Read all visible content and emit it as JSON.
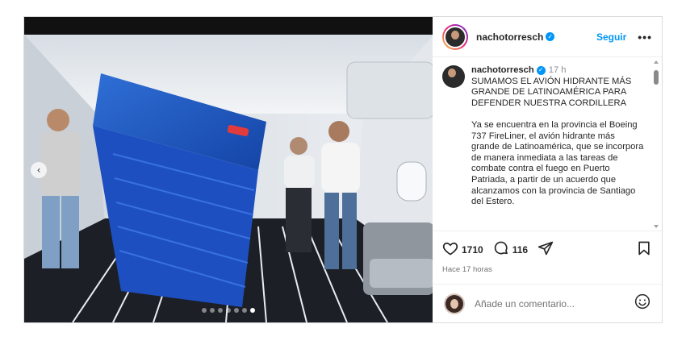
{
  "post": {
    "username": "nachotorresch",
    "follow_label": "Seguir",
    "more_label": "•••",
    "caption": {
      "time": "17 h",
      "headline": "SUMAMOS EL AVIÓN HIDRANTE MÁS GRANDE DE LATINOAMÉRICA PARA DEFENDER NUESTRA CORDILLERA",
      "body": "Ya se encuentra en la provincia el Boeing 737 FireLiner, el avión hidrante más grande de Latinoamérica, que se incorpora de manera inmediata a las tareas de combate contra el fuego en Puerto Patriada, a partir de un acuerdo que alcanzamos con la provincia de Santiago del Estero."
    },
    "likes": "1710",
    "comments_count": "116",
    "posted_ago": "Hace 17 horas",
    "comment_placeholder": "Añade un comentario...",
    "carousel": {
      "total": 7,
      "active": 7
    }
  },
  "icons": {
    "verified": "verified-badge-icon",
    "like": "heart-icon",
    "comment": "comment-icon",
    "share": "send-icon",
    "save": "bookmark-icon",
    "emoji": "emoji-icon",
    "prev": "chevron-left-icon"
  },
  "colors": {
    "accent": "#0095f6",
    "text": "#262626",
    "muted": "#737373",
    "border": "#dbdbdb"
  }
}
